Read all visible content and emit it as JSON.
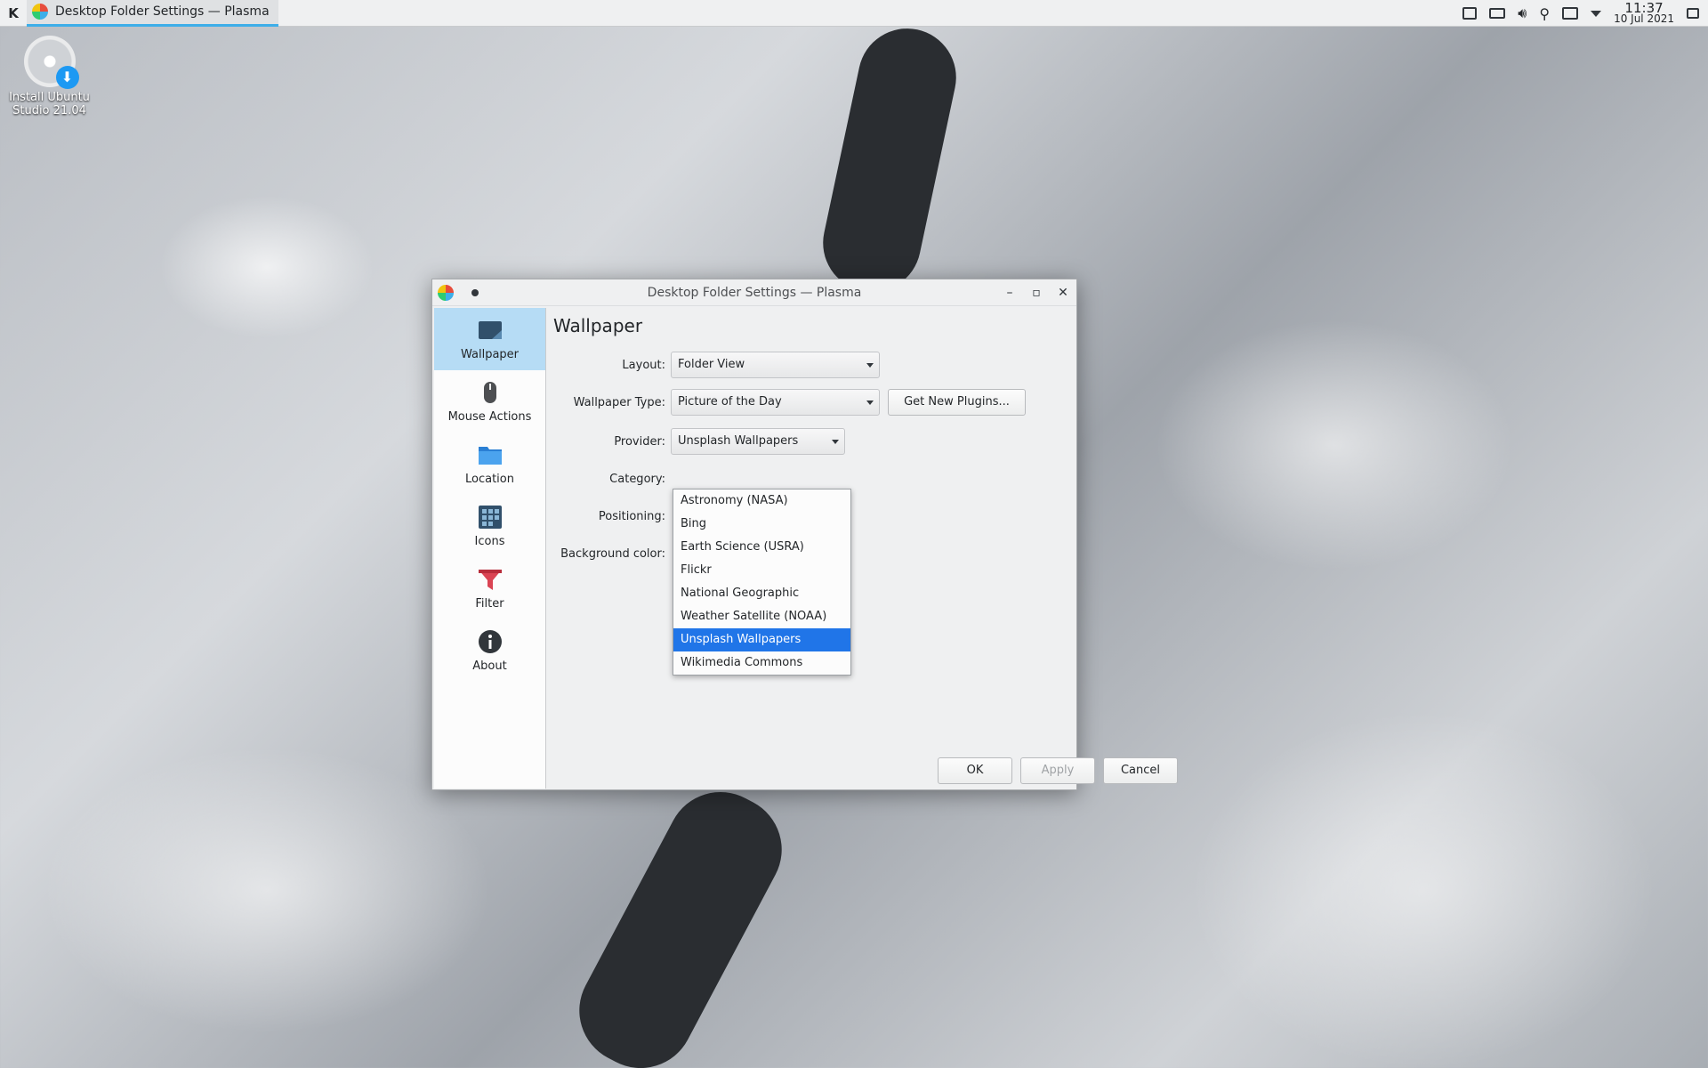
{
  "panel": {
    "launcher_glyph": "K",
    "task_title": "Desktop Folder Settings — Plasma",
    "clock_time": "11:37",
    "clock_date": "10 Jul 2021"
  },
  "desktop": {
    "icon_label": "Install Ubuntu Studio 21.04"
  },
  "window": {
    "title": "Desktop Folder Settings — Plasma",
    "sidebar": [
      {
        "label": "Wallpaper",
        "icon": "wallpaper-icon",
        "active": true
      },
      {
        "label": "Mouse Actions",
        "icon": "mouse-icon"
      },
      {
        "label": "Location",
        "icon": "folder-icon"
      },
      {
        "label": "Icons",
        "icon": "icons-grid-icon"
      },
      {
        "label": "Filter",
        "icon": "filter-icon"
      },
      {
        "label": "About",
        "icon": "info-icon"
      }
    ],
    "page_title": "Wallpaper",
    "layout_label": "Layout:",
    "layout_value": "Folder View",
    "wallpaper_type_label": "Wallpaper Type:",
    "wallpaper_type_value": "Picture of the Day",
    "get_plugins": "Get New Plugins...",
    "provider_label": "Provider:",
    "provider_value": "Unsplash Wallpapers",
    "category_label": "Category:",
    "positioning_label": "Positioning:",
    "bgcolor_label": "Background color:",
    "provider_options": [
      "Astronomy (NASA)",
      "Bing",
      "Earth Science (USRA)",
      "Flickr",
      "National Geographic",
      "Weather Satellite (NOAA)",
      "Unsplash Wallpapers",
      "Wikimedia Commons"
    ],
    "selected_option": "Unsplash Wallpapers",
    "ok": "OK",
    "apply": "Apply",
    "cancel": "Cancel"
  },
  "colors": {
    "accent": "#3daee9",
    "selection": "#2075e8"
  }
}
